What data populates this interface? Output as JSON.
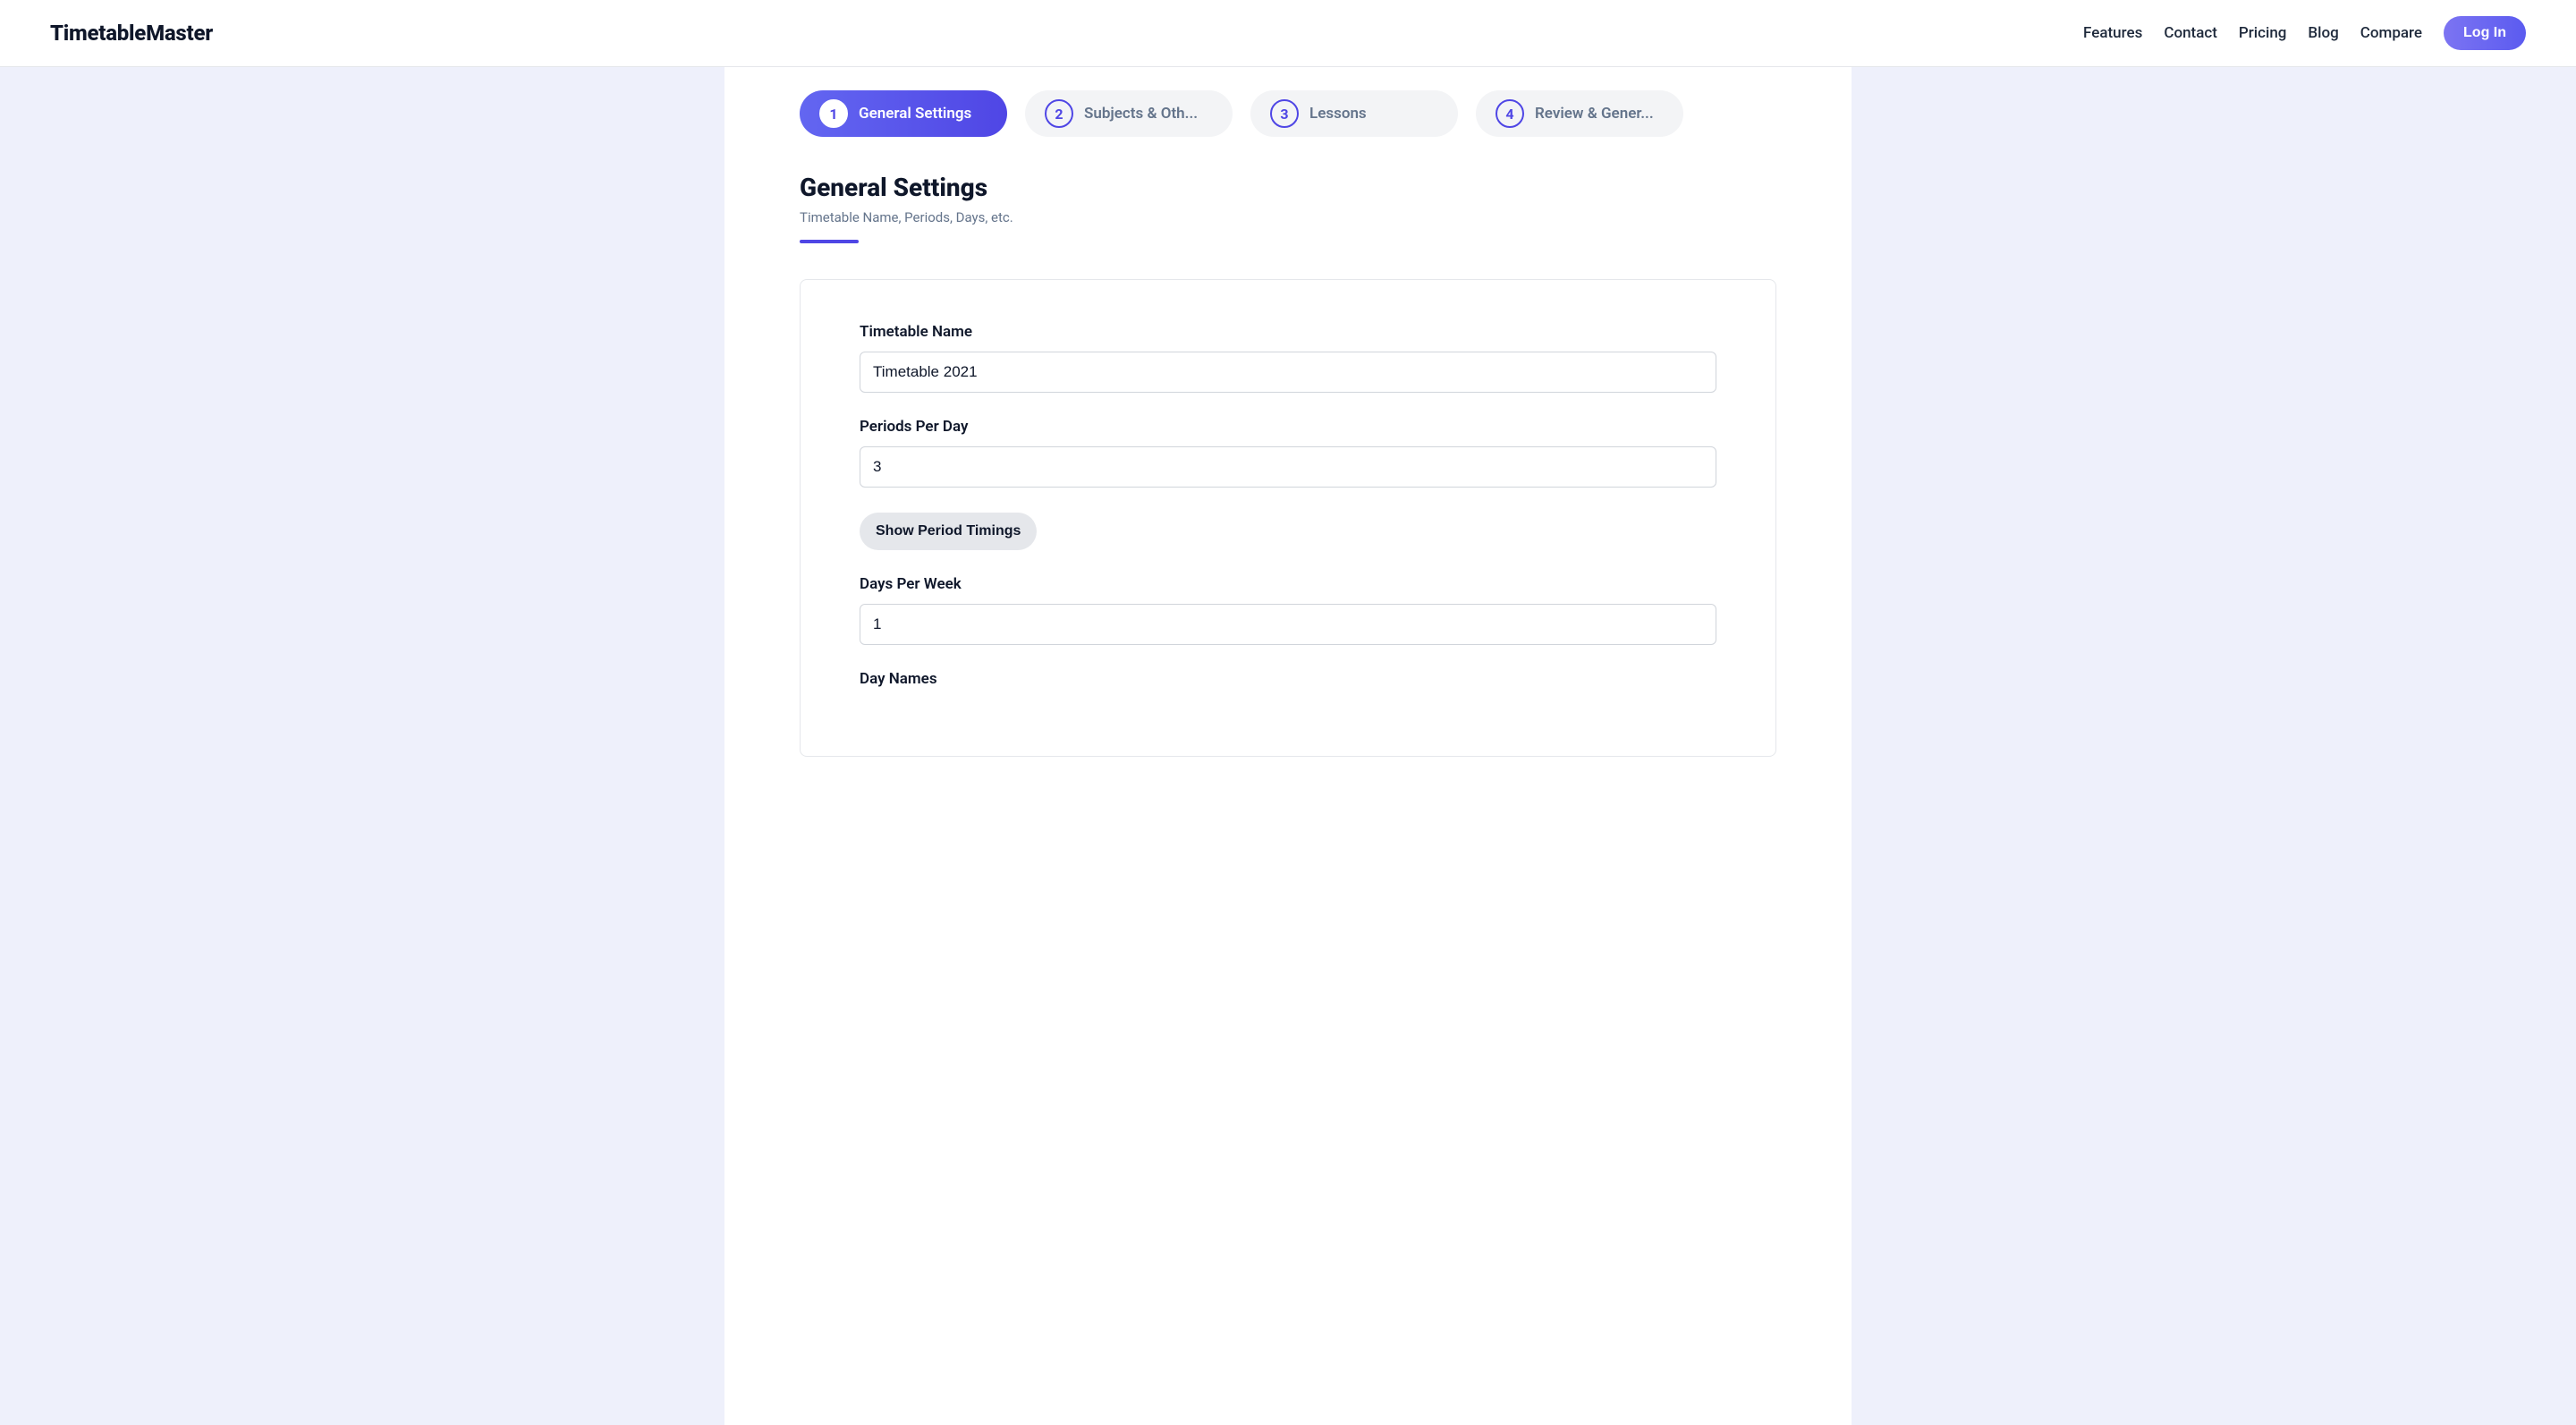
{
  "brand": "TimetableMaster",
  "nav": {
    "features": "Features",
    "contact": "Contact",
    "pricing": "Pricing",
    "blog": "Blog",
    "compare": "Compare",
    "login": "Log In"
  },
  "steps": [
    {
      "num": "1",
      "label": "General Settings",
      "active": true
    },
    {
      "num": "2",
      "label": "Subjects & Oth...",
      "active": false
    },
    {
      "num": "3",
      "label": "Lessons",
      "active": false
    },
    {
      "num": "4",
      "label": "Review & Gener...",
      "active": false
    }
  ],
  "section": {
    "title": "General Settings",
    "subtitle": "Timetable Name, Periods, Days, etc."
  },
  "form": {
    "timetable_name": {
      "label": "Timetable Name",
      "value": "Timetable 2021"
    },
    "periods_per_day": {
      "label": "Periods Per Day",
      "value": "3"
    },
    "show_timings_btn": "Show Period Timings",
    "days_per_week": {
      "label": "Days Per Week",
      "value": "1"
    },
    "day_names": {
      "label": "Day Names"
    }
  }
}
